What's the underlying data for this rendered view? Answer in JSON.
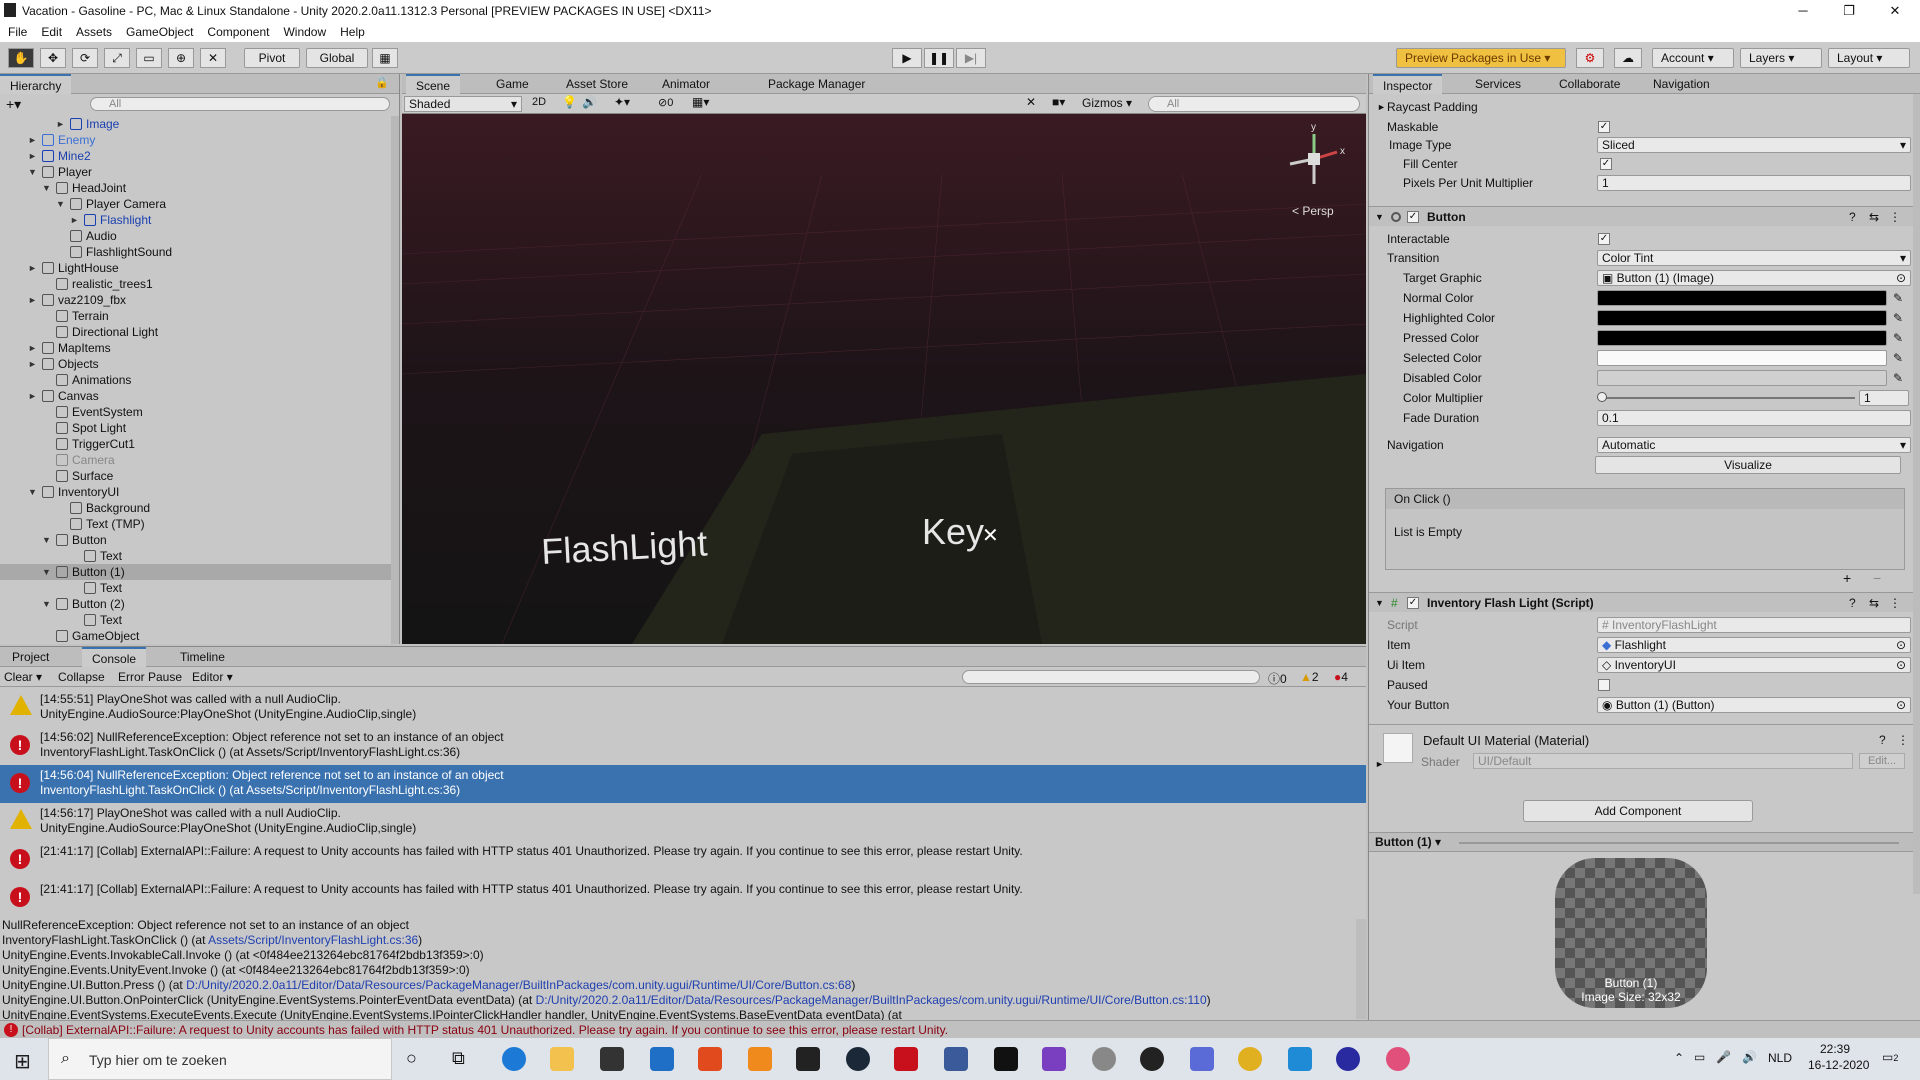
{
  "window": {
    "title": "Vacation - Gasoline - PC, Mac & Linux Standalone - Unity 2020.2.0a11.1312.3 Personal [PREVIEW PACKAGES IN USE] <DX11>"
  },
  "menu": [
    "File",
    "Edit",
    "Assets",
    "GameObject",
    "Component",
    "Window",
    "Help"
  ],
  "toolbar": {
    "pivot": "Pivot",
    "global": "Global",
    "preview_packages": "Preview Packages in Use",
    "account": "Account",
    "layers": "Layers",
    "layout": "Layout"
  },
  "hierarchy": {
    "tab": "Hierarchy",
    "search_placeholder": "All",
    "items": [
      {
        "label": "Image",
        "indent": 5,
        "arrow": "►",
        "color": "#1a3fb0"
      },
      {
        "label": "Enemy",
        "indent": 3,
        "arrow": "►",
        "color": "#3b6fd4"
      },
      {
        "label": "Mine2",
        "indent": 3,
        "arrow": "►",
        "color": "#1a3fb0"
      },
      {
        "label": "Player",
        "indent": 3,
        "arrow": "▼",
        "color": "#111"
      },
      {
        "label": "HeadJoint",
        "indent": 4,
        "arrow": "▼",
        "color": "#111"
      },
      {
        "label": "Player Camera",
        "indent": 5,
        "arrow": "▼",
        "color": "#111"
      },
      {
        "label": "Flashlight",
        "indent": 6,
        "arrow": "►",
        "color": "#1a3fb0"
      },
      {
        "label": "Audio",
        "indent": 5,
        "arrow": "",
        "color": "#111"
      },
      {
        "label": "FlashlightSound",
        "indent": 5,
        "arrow": "",
        "color": "#111"
      },
      {
        "label": "LightHouse",
        "indent": 3,
        "arrow": "►",
        "color": "#111"
      },
      {
        "label": "realistic_trees1",
        "indent": 4,
        "arrow": "",
        "color": "#111"
      },
      {
        "label": "vaz2109_fbx",
        "indent": 3,
        "arrow": "►",
        "color": "#111"
      },
      {
        "label": "Terrain",
        "indent": 4,
        "arrow": "",
        "color": "#111"
      },
      {
        "label": "Directional Light",
        "indent": 4,
        "arrow": "",
        "color": "#111"
      },
      {
        "label": "MapItems",
        "indent": 3,
        "arrow": "►",
        "color": "#111"
      },
      {
        "label": "Objects",
        "indent": 3,
        "arrow": "►",
        "color": "#111"
      },
      {
        "label": "Animations",
        "indent": 4,
        "arrow": "",
        "color": "#111"
      },
      {
        "label": "Canvas",
        "indent": 3,
        "arrow": "►",
        "color": "#111"
      },
      {
        "label": "EventSystem",
        "indent": 4,
        "arrow": "",
        "color": "#111"
      },
      {
        "label": "Spot Light",
        "indent": 4,
        "arrow": "",
        "color": "#111"
      },
      {
        "label": "TriggerCut1",
        "indent": 4,
        "arrow": "",
        "color": "#111"
      },
      {
        "label": "Camera",
        "indent": 4,
        "arrow": "",
        "color": "#888"
      },
      {
        "label": "Surface",
        "indent": 4,
        "arrow": "",
        "color": "#111"
      },
      {
        "label": "InventoryUI",
        "indent": 3,
        "arrow": "▼",
        "color": "#111"
      },
      {
        "label": "Background",
        "indent": 5,
        "arrow": "",
        "color": "#111"
      },
      {
        "label": "Text (TMP)",
        "indent": 5,
        "arrow": "",
        "color": "#111"
      },
      {
        "label": "Button",
        "indent": 4,
        "arrow": "▼",
        "color": "#111"
      },
      {
        "label": "Text",
        "indent": 6,
        "arrow": "",
        "color": "#111"
      },
      {
        "label": "Button (1)",
        "indent": 4,
        "arrow": "▼",
        "color": "#111"
      },
      {
        "label": "Text",
        "indent": 6,
        "arrow": "",
        "color": "#111"
      },
      {
        "label": "Button (2)",
        "indent": 4,
        "arrow": "▼",
        "color": "#111"
      },
      {
        "label": "Text",
        "indent": 6,
        "arrow": "",
        "color": "#111"
      },
      {
        "label": "GameObject",
        "indent": 4,
        "arrow": "",
        "color": "#111"
      }
    ],
    "selected_index": 28
  },
  "scene": {
    "tabs": [
      "Scene",
      "Game",
      "Asset Store",
      "Animator",
      "Package Manager"
    ],
    "shading": "Shaded",
    "mode_2d": "2D",
    "hidden_count": "0",
    "gizmos": "Gizmos",
    "search_placeholder": "All",
    "persp": "< Persp",
    "label_flashlight": "FlashLight",
    "label_key": "Key"
  },
  "inspector": {
    "tabs": [
      "Inspector",
      "Services",
      "Collaborate",
      "Navigation"
    ],
    "raycast_padding": "Raycast Padding",
    "maskable": "Maskable",
    "image_type_label": "Image Type",
    "image_type": "Sliced",
    "fill_center": "Fill Center",
    "ppu_label": "Pixels Per Unit Multiplier",
    "ppu": "1",
    "button_header": "Button",
    "interactable": "Interactable",
    "transition_label": "Transition",
    "transition": "Color Tint",
    "target_graphic_label": "Target Graphic",
    "target_graphic": "Button (1) (Image)",
    "normal_color": "Normal Color",
    "highlighted_color": "Highlighted Color",
    "pressed_color": "Pressed Color",
    "selected_color": "Selected Color",
    "disabled_color": "Disabled Color",
    "color_multiplier_label": "Color Multiplier",
    "color_multiplier": "1",
    "fade_duration_label": "Fade Duration",
    "fade_duration": "0.1",
    "navigation_label": "Navigation",
    "navigation": "Automatic",
    "visualize": "Visualize",
    "on_click": "On Click ()",
    "list_empty": "List is Empty",
    "script_header": "Inventory Flash Light (Script)",
    "script_label": "Script",
    "script_value": "InventoryFlashLight",
    "item_label": "Item",
    "item_value": "Flashlight",
    "ui_item_label": "Ui Item",
    "ui_item_value": "InventoryUI",
    "paused_label": "Paused",
    "your_button_label": "Your Button",
    "your_button_value": "Button (1) (Button)",
    "material_name": "Default UI Material (Material)",
    "shader_label": "Shader",
    "shader_value": "UI/Default",
    "edit": "Edit...",
    "add_component": "Add Component",
    "preview_title": "Button (1)",
    "preview_caption1": "Button (1)",
    "preview_caption2": "Image Size: 32x32"
  },
  "console": {
    "tabs": [
      "Project",
      "Console",
      "Timeline"
    ],
    "buttons": [
      "Clear",
      "Collapse",
      "Error Pause",
      "Editor"
    ],
    "counts": {
      "info": "0",
      "warn": "2",
      "error": "4"
    },
    "entries": [
      {
        "type": "warn",
        "l1": "[14:55:51] PlayOneShot was called with a null AudioClip.",
        "l2": "UnityEngine.AudioSource:PlayOneShot (UnityEngine.AudioClip,single)"
      },
      {
        "type": "error",
        "l1": "[14:56:02] NullReferenceException: Object reference not set to an instance of an object",
        "l2": "InventoryFlashLight.TaskOnClick () (at Assets/Script/InventoryFlashLight.cs:36)"
      },
      {
        "type": "error",
        "l1": "[14:56:04] NullReferenceException: Object reference not set to an instance of an object",
        "l2": "InventoryFlashLight.TaskOnClick () (at Assets/Script/InventoryFlashLight.cs:36)"
      },
      {
        "type": "warn",
        "l1": "[14:56:17] PlayOneShot was called with a null AudioClip.",
        "l2": "UnityEngine.AudioSource:PlayOneShot (UnityEngine.AudioClip,single)"
      },
      {
        "type": "error",
        "l1": "[21:41:17] [Collab] ExternalAPI::Failure: A request to Unity accounts has failed with HTTP status 401 Unauthorized. Please try again. If you continue to see this error, please restart Unity.",
        "l2": ""
      },
      {
        "type": "error",
        "l1": "[21:41:17] [Collab] ExternalAPI::Failure: A request to Unity accounts has failed with HTTP status 401 Unauthorized. Please try again. If you continue to see this error, please restart Unity.",
        "l2": ""
      }
    ],
    "selected_index": 2,
    "stack": [
      {
        "pre": "NullReferenceException: Object reference not set to an instance of an object",
        "link": "",
        "post": ""
      },
      {
        "pre": "InventoryFlashLight.TaskOnClick () (at ",
        "link": "Assets/Script/InventoryFlashLight.cs:36",
        "post": ")"
      },
      {
        "pre": "UnityEngine.Events.InvokableCall.Invoke () (at <0f484ee213264ebc81764f2bdb13f359>:0)",
        "link": "",
        "post": ""
      },
      {
        "pre": "UnityEngine.Events.UnityEvent.Invoke () (at <0f484ee213264ebc81764f2bdb13f359>:0)",
        "link": "",
        "post": ""
      },
      {
        "pre": "UnityEngine.UI.Button.Press () (at ",
        "link": "D:/Unity/2020.2.0a11/Editor/Data/Resources/PackageManager/BuiltInPackages/com.unity.ugui/Runtime/UI/Core/Button.cs:68",
        "post": ")"
      },
      {
        "pre": "UnityEngine.UI.Button.OnPointerClick (UnityEngine.EventSystems.PointerEventData eventData) (at ",
        "link": "D:/Unity/2020.2.0a11/Editor/Data/Resources/PackageManager/BuiltInPackages/com.unity.ugui/Runtime/UI/Core/Button.cs:110",
        "post": ")"
      },
      {
        "pre": "UnityEngine.EventSystems.ExecuteEvents.Execute (UnityEngine.EventSystems.IPointerClickHandler handler, UnityEngine.EventSystems.BaseEventData eventData) (at",
        "link": "",
        "post": ""
      }
    ]
  },
  "status": "[Collab] ExternalAPI::Failure: A request to Unity accounts has failed with HTTP status 401 Unauthorized. Please try again. If you continue to see this error, please restart Unity.",
  "taskbar": {
    "search_placeholder": "Typ hier om te zoeken",
    "lang": "NLD",
    "time": "22:39",
    "date": "16-12-2020",
    "notif": "2"
  }
}
